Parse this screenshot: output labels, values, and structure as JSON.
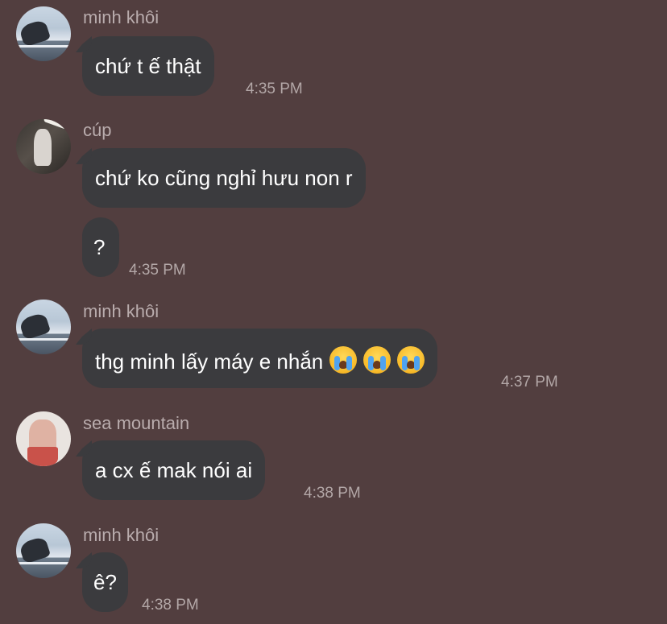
{
  "messages": [
    {
      "sender": "minh khôi",
      "bubbles": [
        "chứ t ế thật"
      ],
      "time": "4:35 PM"
    },
    {
      "sender": "cúp",
      "bubbles": [
        "chứ ko cũng nghỉ hưu non r",
        "?"
      ],
      "time": "4:35 PM"
    },
    {
      "sender": "minh khôi",
      "text": "thg minh lấy máy e nhắn",
      "emoji": [
        "crying-face",
        "crying-face",
        "crying-face"
      ],
      "time": "4:37 PM"
    },
    {
      "sender": "sea mountain",
      "bubbles": [
        "a cx ế mak nói ai"
      ],
      "time": "4:38 PM"
    },
    {
      "sender": "minh khôi",
      "bubbles": [
        "ê?"
      ],
      "time": "4:38 PM"
    }
  ],
  "colors": {
    "background": "#523e3f",
    "bubble": "#3b3b3e",
    "name": "#b9acad",
    "time": "#b3a7a7"
  }
}
